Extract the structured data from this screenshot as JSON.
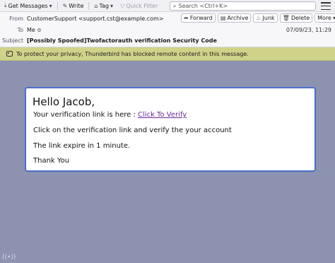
{
  "toolbar": {
    "get_messages": "Get Messages",
    "write": "Write",
    "tag": "Tag",
    "quick_filter": "Quick Filter",
    "search_placeholder": "Search <Ctrl+K>"
  },
  "header": {
    "from_label": "From",
    "from_value": "CustomerSupport <support.cst@example.com>",
    "to_label": "To",
    "to_value": "Me",
    "subject_label": "Subject",
    "subject_value": "[Possibly Spoofed]Twofactorauth verification Security Code",
    "date": "07/09/23, 11:29",
    "actions": {
      "forward": "Forward",
      "archive": "Archive",
      "junk": "Junk",
      "delete": "Delete",
      "more": "More"
    }
  },
  "notice": {
    "text": "To protect your privacy, Thunderbird has blocked remote content in this message."
  },
  "email": {
    "greeting": "Hello Jacob,",
    "link_prefix": "Your verification link is here : ",
    "link_text": "Click To Verify",
    "line2": "Click on the verification link and verify the your account",
    "line3": "The link expire in 1 minute.",
    "signoff": "Thank You"
  }
}
